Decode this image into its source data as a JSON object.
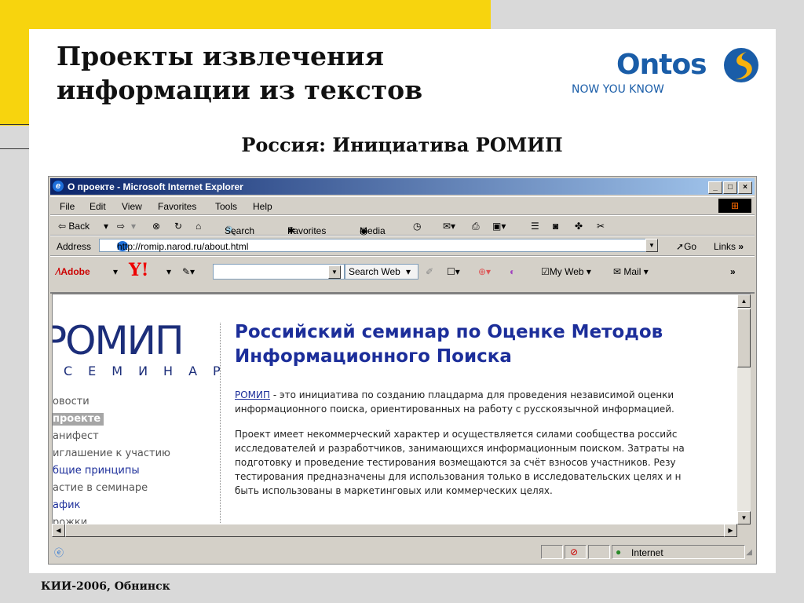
{
  "slide": {
    "title_line1": "Проекты извлечения",
    "title_line2": "информации из текстов",
    "subtitle": "Россия: Инициатива РОМИП",
    "footer": "КИИ-2006, Обнинск",
    "logo": {
      "name": "Ontos",
      "tagline": "NOW YOU KNOW"
    }
  },
  "window": {
    "title": "О проекте - Microsoft Internet Explorer",
    "controls": [
      "_",
      "□",
      "×"
    ]
  },
  "menu": [
    "File",
    "Edit",
    "View",
    "Favorites",
    "Tools",
    "Help"
  ],
  "toolbar": {
    "back": "⇦ Back",
    "forward": "⇨",
    "search": "Search",
    "favorites": "Favorites",
    "media": "Media"
  },
  "address": {
    "label": "Address",
    "url": "http://romip.narod.ru/about.html",
    "go": "Go",
    "links": "Links"
  },
  "yahoo": {
    "adobe": "Adobe",
    "yahoo": "Y!",
    "search_web": "Search Web",
    "my_web": "My Web",
    "mail": "Mail",
    "more": "»"
  },
  "page": {
    "brand": "РОМИП",
    "brand_sub": "СЕМИНАР",
    "nav": [
      "овости",
      "проекте",
      "анифест",
      "иглашение к участию",
      "бщие принципы",
      "астие в семинаре",
      "афик",
      "рожки"
    ],
    "heading_line1": "Российский семинар по Оценке Методов",
    "heading_line2": "Информационного Поиска",
    "p1_link": "РОМИП",
    "p1_line1": " - это инициатива по созданию плацдарма для проведения независимой оценки",
    "p1_line2": "информационного поиска, ориентированных на работу с русскоязычной информацией.",
    "p2_line1": "Проект имеет некоммерческий характер и осуществляется силами сообщества российс",
    "p2_line2": "исследователей и разработчиков, занимающихся информационным поиском. Затраты на",
    "p2_line3": "подготовку и проведение тестирования возмещаются за счёт взносов участников. Резу",
    "p2_line4": "тестирования предназначены для использования только в исследовательских целях и н",
    "p2_line5": "быть использованы в маркетинговых или коммерческих целях."
  },
  "status": {
    "zone": "Internet"
  },
  "colors": {
    "yellow": "#f7d40e",
    "ie_title": "#0a246a",
    "romip_blue": "#1c2e9a",
    "ontos_blue": "#1a5da8"
  }
}
